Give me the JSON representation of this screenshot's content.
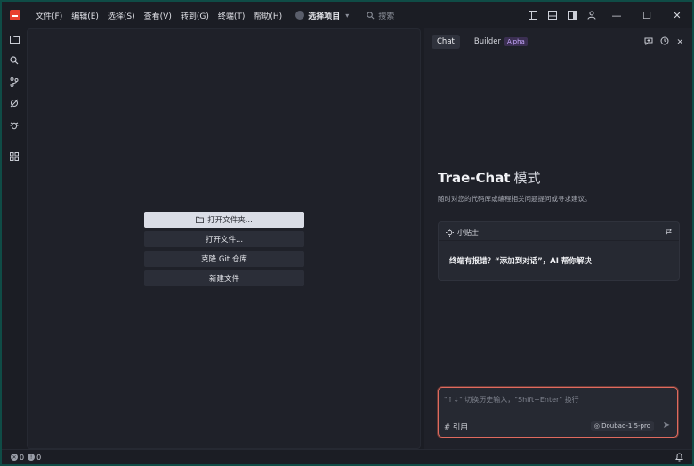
{
  "menu": [
    "文件(F)",
    "编辑(E)",
    "选择(S)",
    "查看(V)",
    "转到(G)",
    "终端(T)",
    "帮助(H)"
  ],
  "project": {
    "label": "选择项目"
  },
  "search": {
    "label": "搜索"
  },
  "editor": {
    "open_folder": "打开文件夹...",
    "open_file": "打开文件...",
    "clone_git": "克隆 Git 仓库",
    "new_file": "新建文件"
  },
  "chat": {
    "tabs": {
      "chat": "Chat",
      "builder": "Builder",
      "alpha": "Alpha"
    },
    "title": "Trae-Chat",
    "title_mode": "模式",
    "subtitle": "随时对您的代码库或编程相关问题提问或寻求建议。",
    "tip_header": "小贴士",
    "tip_body": "终端有报错？“添加到对话”，AI 帮你解决",
    "input_placeholder": "\"↑↓\" 切换历史输入，\"Shift+Enter\" 换行",
    "reference_label": "# 引用",
    "model": "Doubao-1.5-pro"
  },
  "status": {
    "errors": "0",
    "warnings": "0"
  },
  "colors": {
    "accent_red": "#e8402f",
    "input_border": "#e06a5e",
    "bg": "#1b1d24",
    "panel": "#1f2129"
  }
}
